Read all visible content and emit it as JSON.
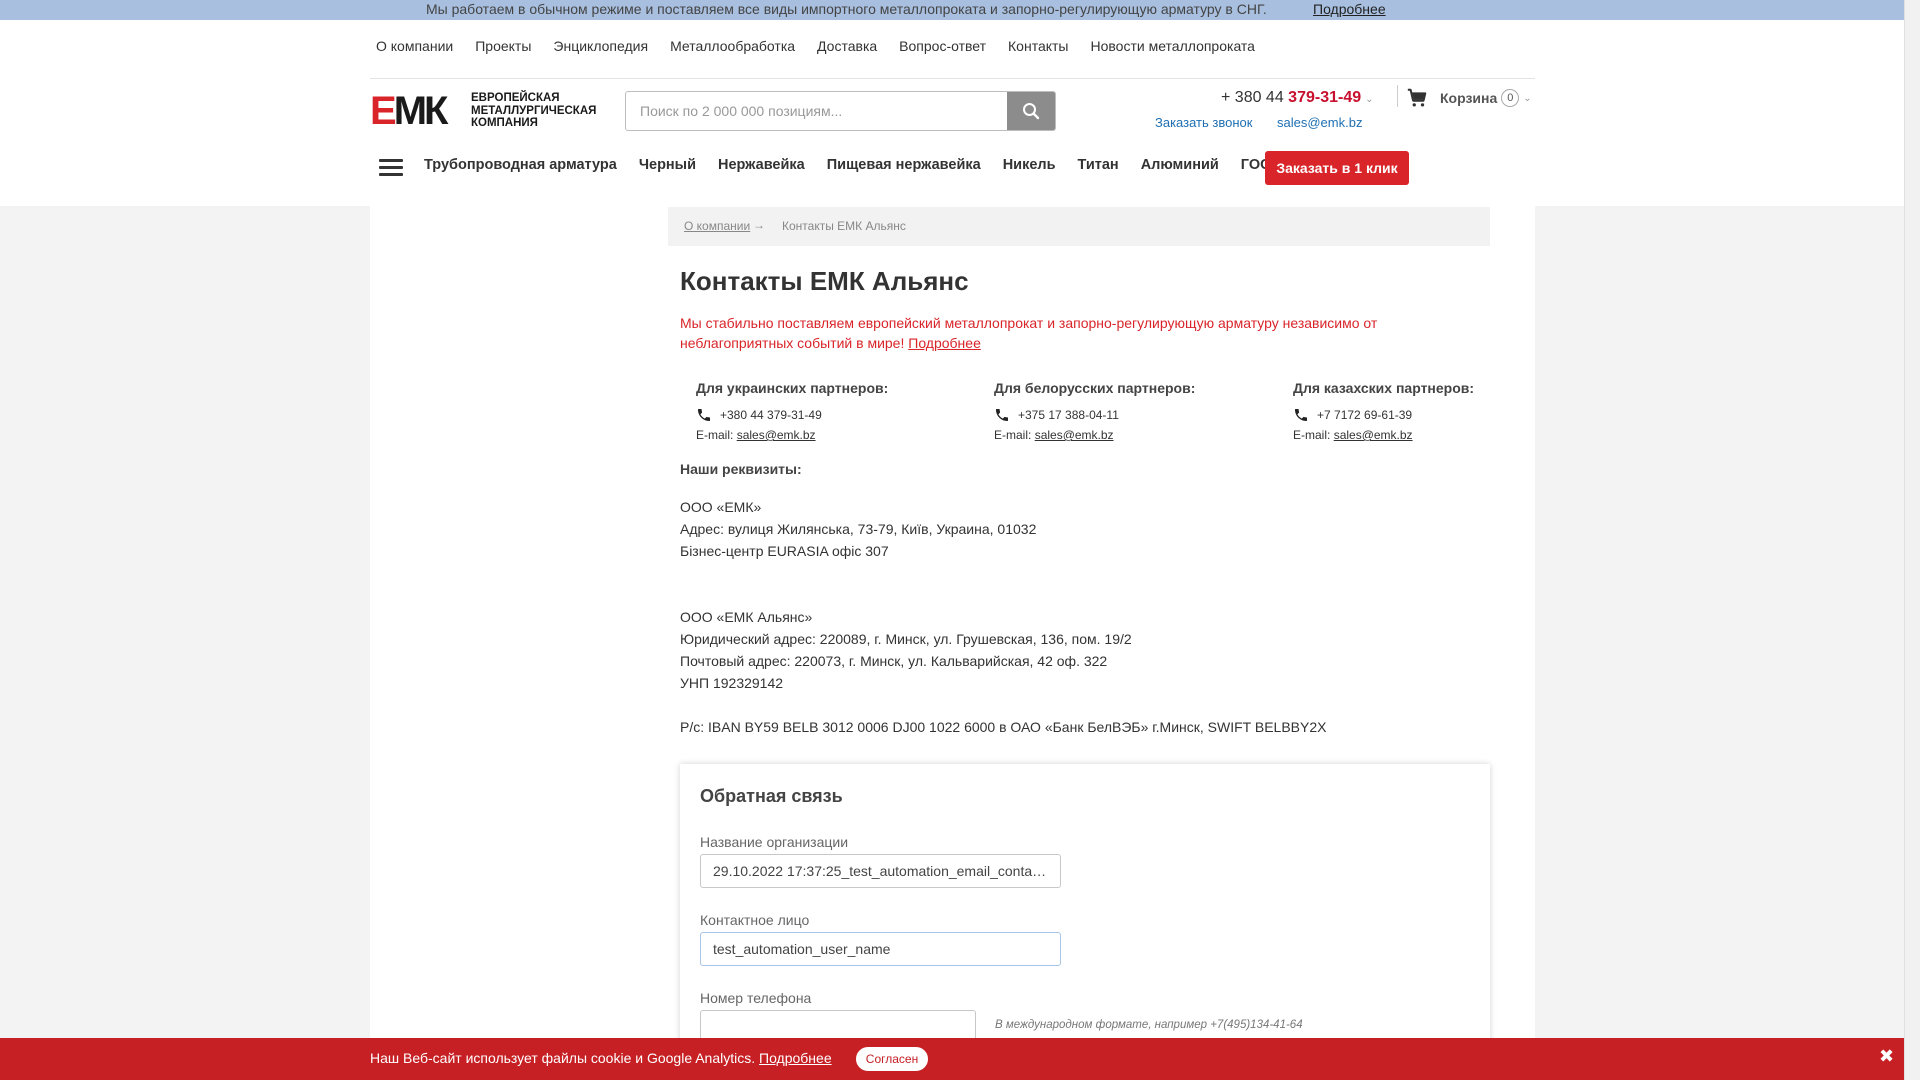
{
  "topbar": {
    "notice": "Мы работаем в обычном режиме и поставляем все виды импортного металлопроката и запорно-регулирующую арматуру в СНГ.",
    "more": "Подробнее"
  },
  "top_menu": [
    "О компании",
    "Проекты",
    "Энциклопедия",
    "Металлообработка",
    "Доставка",
    "Вопрос-ответ",
    "Контакты",
    "Новости металлопроката"
  ],
  "logo": {
    "mark_e": "Е",
    "mark_mk": "МК",
    "line1": "ЕВРОПЕЙСКАЯ",
    "line2": "МЕТАЛЛУРГИЧЕСКАЯ",
    "line3": "КОМПАНИЯ"
  },
  "search": {
    "placeholder": "Поиск по 2 000 000 позициям...",
    "icon": "search-icon"
  },
  "header": {
    "phone_prefix": "+ 380 44 ",
    "phone_main": "379-31-49",
    "callback": "Заказать звонок",
    "email": "sales@emk.bz",
    "cart_label": "Корзина",
    "cart_count": "0"
  },
  "category_menu": [
    "Трубопроводная арматура",
    "Черный",
    "Нержавейка",
    "Пищевая нержавейка",
    "Никель",
    "Титан",
    "Алюминий",
    "ГОСТ"
  ],
  "order_button": "Заказать в 1 клик",
  "breadcrumb": {
    "parent": "О компании",
    "arrow": "→",
    "current": "Контакты ЕМК Альянс"
  },
  "page_title": "Контакты ЕМК Альянс",
  "lead": {
    "text": "Мы стабильно поставляем европейский металлопрокат и запорно-регулирующую арматуру независимо от неблагоприятных событий в мире!",
    "more": "Подробнее"
  },
  "contacts": [
    {
      "title": "Для украинских партнеров:",
      "phone": "+380 44 379-31-49",
      "email_label": "E-mail:",
      "email": "sales@emk.bz"
    },
    {
      "title": "Для белорусских партнеров:",
      "phone": "+375 17 388-04-11",
      "email_label": "E-mail:",
      "email": "sales@emk.bz"
    },
    {
      "title": "Для казахских партнеров:",
      "phone": "+7 7172 69-61-39",
      "email_label": "E-mail:",
      "email": "sales@emk.bz"
    }
  ],
  "requisites": {
    "title": "Наши реквизиты:",
    "ua_name": "ООО «ЕМК»",
    "ua_address": "Адрес: вулиця Жилянська, 73-79, Київ, Украина, 01032",
    "ua_office": "Бізнес-центр EURASIA офіс 307",
    "by_name": "ООО «ЕМК Альянс»",
    "by_legal": "Юридический адрес: 220089, г. Минск, ул. Грушевская, 136, пом. 19/2",
    "by_postal": "Почтовый адрес: 220073, г. Минск, ул. Кальварийская, 42 оф. 322",
    "by_unp": "УНП 192329142",
    "by_account": "Р/с: IBAN BY59 BELB 3012 0006 DJ00 1022 6000 в ОАО «Банк БелВЭБ» г.Минск, SWIFT BELBBY2X"
  },
  "form": {
    "title": "Обратная связь",
    "org_label": "Название организации",
    "org_value": "29.10.2022 17:37:25_test_automation_email_conta…",
    "contact_label": "Контактное лицо",
    "contact_value": "test_automation_user_name",
    "phone_label": "Номер телефона",
    "phone_value": "",
    "phone_hint": "В международном формате, например +7(495)134-41-64"
  },
  "cookie": {
    "text": "Наш Веб-сайт использует файлы cookie и Google Analytics.",
    "more": "Подробнее",
    "agree": "Согласен",
    "close": "✖"
  },
  "colors": {
    "brand_red": "#d9252a",
    "link_blue": "#1f6fb2",
    "topbar_blue": "#a8bfdf",
    "cookie_red": "#c61f24"
  }
}
